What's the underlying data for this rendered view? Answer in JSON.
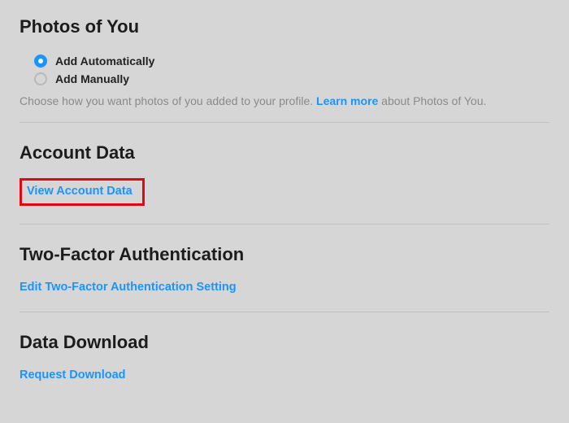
{
  "photos": {
    "title": "Photos of You",
    "options": {
      "auto": "Add Automatically",
      "manual": "Add Manually"
    },
    "help_prefix": "Choose how you want photos of you added to your profile. ",
    "learn_more": "Learn more",
    "help_suffix": " about Photos of You."
  },
  "account_data": {
    "title": "Account Data",
    "link": "View Account Data"
  },
  "two_factor": {
    "title": "Two-Factor Authentication",
    "link": "Edit Two-Factor Authentication Setting"
  },
  "data_download": {
    "title": "Data Download",
    "link": "Request Download"
  }
}
